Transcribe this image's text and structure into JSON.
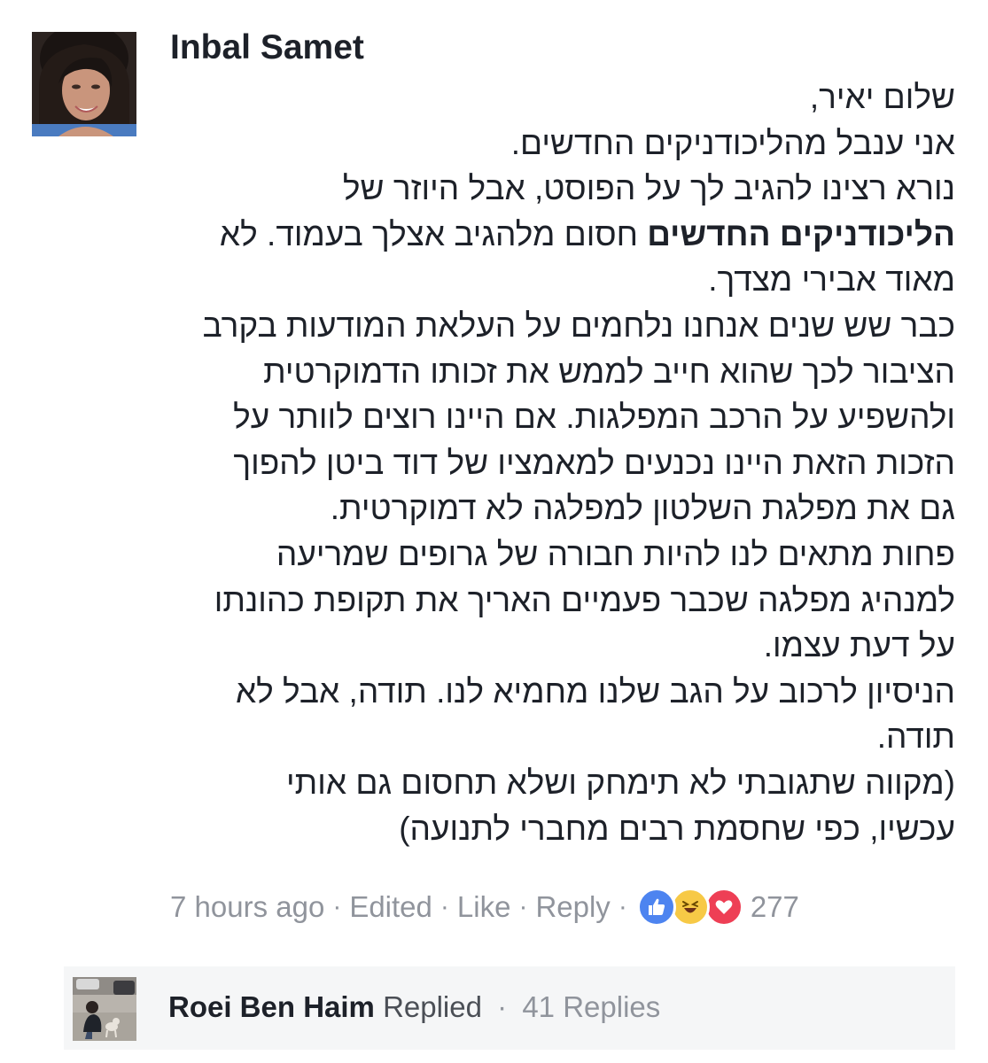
{
  "comment": {
    "author": "Inbal Samet",
    "lines": [
      {
        "text": "שלום יאיר,"
      },
      {
        "text": "אני ענבל מהליכודניקים החדשים."
      },
      {
        "text": "נורא רצינו להגיב לך על הפוסט, אבל היוזר של"
      },
      {
        "bold": "הליכודניקים החדשים",
        "text": " חסום מלהגיב אצלך בעמוד. לא"
      },
      {
        "text": "מאוד אבירי מצדך."
      },
      {
        "text": "כבר שש שנים אנחנו נלחמים על העלאת המודעות בקרב"
      },
      {
        "text": "הציבור לכך שהוא חייב לממש את זכותו הדמוקרטית"
      },
      {
        "text": "ולהשפיע על הרכב המפלגות. אם היינו רוצים לוותר על"
      },
      {
        "text": "הזכות הזאת היינו נכנעים למאמציו של דוד ביטן להפוך"
      },
      {
        "text": "גם את מפלגת השלטון למפלגה לא דמוקרטית."
      },
      {
        "text": "פחות מתאים לנו להיות חבורה של גרופים שמריעה"
      },
      {
        "text": "למנהיג מפלגה שכבר פעמיים האריך את תקופת כהונתו"
      },
      {
        "text": "על דעת עצמו."
      },
      {
        "text": "הניסיון לרכוב על הגב שלנו מחמיא לנו. תודה, אבל לא"
      },
      {
        "text": "תודה."
      },
      {
        "text": "(מקווה שתגובתי לא תימחק ושלא תחסום גם אותי"
      },
      {
        "text": "עכשיו, כפי שחסמת רבים מחברי לתנועה)"
      }
    ]
  },
  "meta": {
    "time": "7 hours ago",
    "edited": "Edited",
    "like": "Like",
    "reply": "Reply",
    "separator": "·",
    "reaction_count": "277",
    "reactions": [
      "like-icon",
      "haha-icon",
      "love-icon"
    ],
    "colors": {
      "like": "#4d84f0",
      "haha": "#f7c946",
      "love": "#ee3f55",
      "meta_text": "#90949c"
    }
  },
  "replies": {
    "name": "Roei Ben Haim",
    "action": "Replied",
    "separator": "·",
    "count": "41 Replies"
  }
}
